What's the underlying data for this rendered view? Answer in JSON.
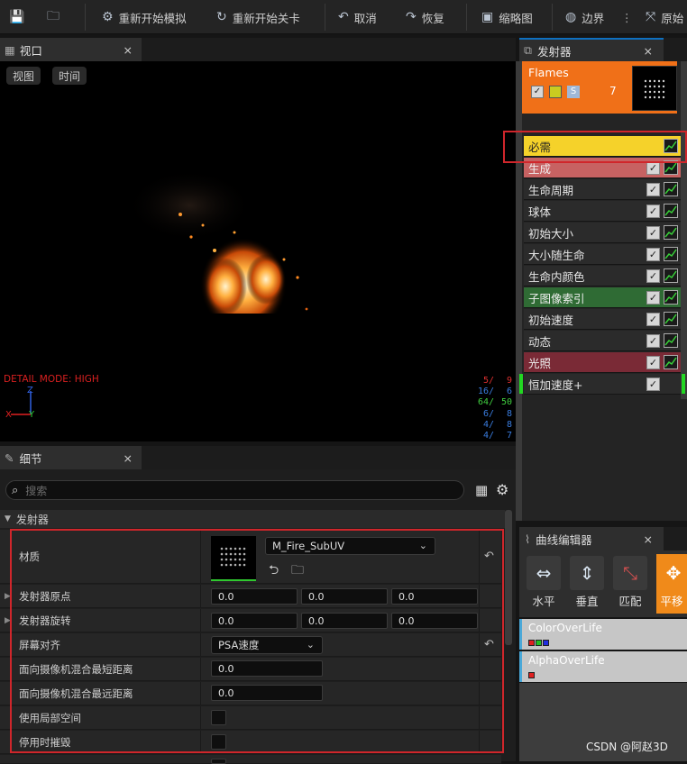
{
  "toolbar": {
    "restart_sim": "重新开始模拟",
    "restart_level": "重新开始关卡",
    "undo": "取消",
    "redo": "恢复",
    "thumbnail": "缩略图",
    "bounds": "边界",
    "origin": "原始"
  },
  "viewport": {
    "tab": "视口",
    "view_btn": "视图",
    "time_btn": "时间",
    "detail_mode": "DETAIL MODE: HIGH",
    "axis_z": "Z",
    "axis_y": "Y",
    "axis_x": "X",
    "stats": [
      {
        "a": "5/",
        "b": "9",
        "color": "#e03030"
      },
      {
        "a": "16/",
        "b": "6",
        "color": "#3a7de0"
      },
      {
        "a": "64/",
        "b": "50",
        "color": "#40d040"
      },
      {
        "a": "6/",
        "b": "8",
        "color": "#3a7de0"
      },
      {
        "a": "4/",
        "b": "8",
        "color": "#3a7de0"
      },
      {
        "a": "4/",
        "b": "7",
        "color": "#3a7de0"
      }
    ]
  },
  "details": {
    "tab": "细节",
    "search_placeholder": "搜索",
    "category": "发射器",
    "material_label": "材质",
    "material_value": "M_Fire_SubUV",
    "origin_label": "发射器原点",
    "origin": [
      "0.0",
      "0.0",
      "0.0"
    ],
    "rotation_label": "发射器旋转",
    "rotation": [
      "0.0",
      "0.0",
      "0.0"
    ],
    "screen_align_label": "屏幕对齐",
    "screen_align_value": "PSA速度",
    "min_fade_label": "面向摄像机混合最短距离",
    "min_fade_value": "0.0",
    "max_fade_label": "面向摄像机混合最远距离",
    "max_fade_value": "0.0",
    "local_space_label": "使用局部空间",
    "kill_on_deactivate_label": "停用时摧毁"
  },
  "emitter": {
    "tab": "发射器",
    "name": "Flames",
    "count": "7",
    "s_badge": "S",
    "modules": [
      {
        "label": "必需",
        "bg": "#f5d22a",
        "fg": "#222222",
        "check": false,
        "curve": true,
        "left_bar": ""
      },
      {
        "label": "生成",
        "bg": "#c76262",
        "fg": "#f0f0f0",
        "check": true,
        "curve": true,
        "left_bar": ""
      },
      {
        "label": "生命周期",
        "bg": "#2b2b2b",
        "fg": "#e6e6e6",
        "check": true,
        "curve": true,
        "left_bar": ""
      },
      {
        "label": "球体",
        "bg": "#2b2b2b",
        "fg": "#e6e6e6",
        "check": true,
        "curve": true,
        "left_bar": ""
      },
      {
        "label": "初始大小",
        "bg": "#2b2b2b",
        "fg": "#e6e6e6",
        "check": true,
        "curve": true,
        "left_bar": ""
      },
      {
        "label": "大小随生命",
        "bg": "#2b2b2b",
        "fg": "#e6e6e6",
        "check": true,
        "curve": true,
        "left_bar": ""
      },
      {
        "label": "生命内颜色",
        "bg": "#2b2b2b",
        "fg": "#e6e6e6",
        "check": true,
        "curve": true,
        "left_bar": ""
      },
      {
        "label": "子图像索引",
        "bg": "#2f6b34",
        "fg": "#f0f0f0",
        "check": true,
        "curve": true,
        "left_bar": ""
      },
      {
        "label": "初始速度",
        "bg": "#2b2b2b",
        "fg": "#e6e6e6",
        "check": true,
        "curve": true,
        "left_bar": ""
      },
      {
        "label": "动态",
        "bg": "#2b2b2b",
        "fg": "#e6e6e6",
        "check": true,
        "curve": true,
        "left_bar": ""
      },
      {
        "label": "光照",
        "bg": "#7a2a36",
        "fg": "#f0f0f0",
        "check": true,
        "curve": true,
        "left_bar": ""
      },
      {
        "label": "恒加速度+",
        "bg": "#2b2b2b",
        "fg": "#e6e6e6",
        "check": true,
        "curve": false,
        "left_bar": "#22d822"
      }
    ]
  },
  "curve_editor": {
    "tab": "曲线编辑器",
    "buttons": [
      "水平",
      "垂直",
      "匹配",
      "平移"
    ],
    "tracks": [
      {
        "name": "ColorOverLife",
        "swatches": [
          "#e02020",
          "#20c020",
          "#2030e0"
        ]
      },
      {
        "name": "AlphaOverLife",
        "swatches": [
          "#e02020"
        ]
      }
    ]
  },
  "watermark": "CSDN @阿赵3D"
}
